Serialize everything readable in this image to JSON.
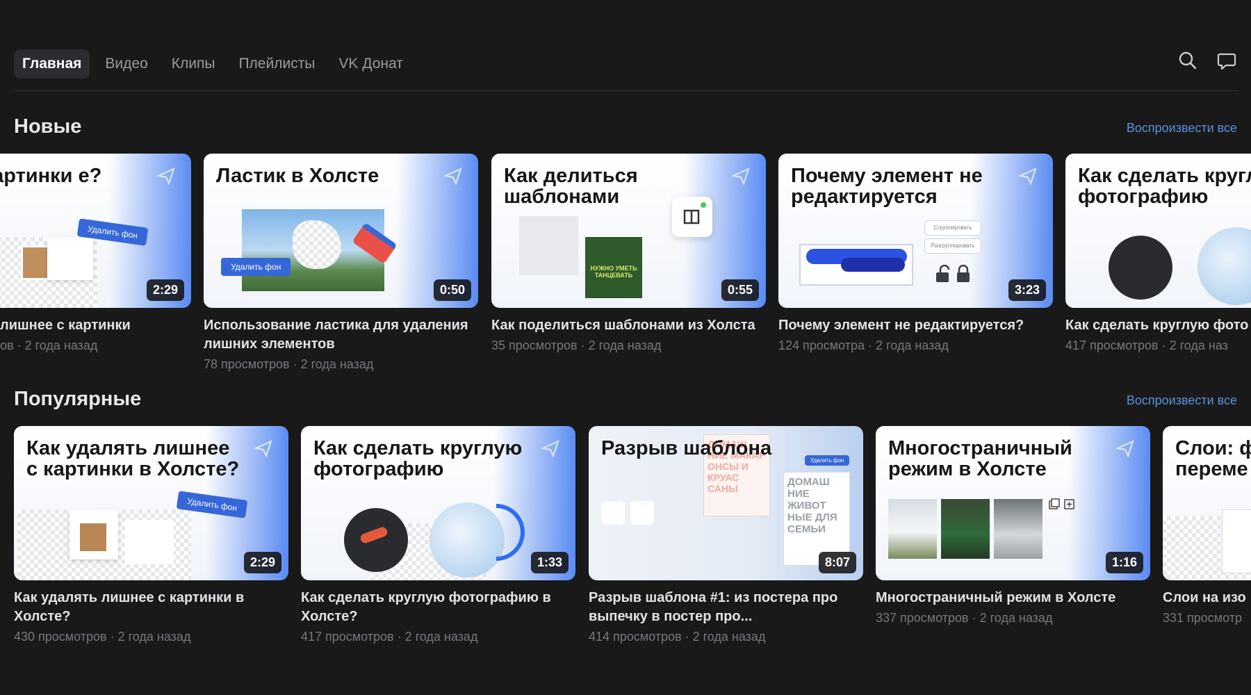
{
  "nav": {
    "tabs": [
      "Главная",
      "Видео",
      "Клипы",
      "Плейлисты",
      "VK Донат"
    ],
    "active_tab": "Главная",
    "icons": [
      "search-icon",
      "chat-icon"
    ]
  },
  "sections": [
    {
      "title": "Новые",
      "play_all": "Воспроизвести все",
      "videos": [
        {
          "thumb_text": "лять с картинки е?",
          "thumb_button": "Удалить фон",
          "duration": "2:29",
          "title": "лишнее с картинки",
          "meta": "ов · 2 года назад"
        },
        {
          "thumb_text": "Ластик в Холсте",
          "thumb_button": "Удалить фон",
          "duration": "0:50",
          "title": "Использование ластика для удаления лишних элементов",
          "meta": "78 просмотров · 2 года назад"
        },
        {
          "thumb_text": "Как делиться шаблонами",
          "thumb_card_text": "НУЖНО УМЕТЬ ТАНЦЕВАТЬ",
          "duration": "0:55",
          "title": "Как поделиться шаблонами из Холста",
          "meta": "35 просмотров · 2 года назад"
        },
        {
          "thumb_text": "Почему элемент не редактируется",
          "thumb_buttons": [
            "Сгруппировать",
            "Разгруппировать"
          ],
          "duration": "3:23",
          "title": "Почему элемент не редактируется?",
          "meta": "124 просмотра · 2 года назад"
        },
        {
          "thumb_text": "Как сделать круглую фотографию",
          "duration": "",
          "title": "Как сделать круглую фото в Холсте?",
          "meta": "417 просмотров · 2 года наз"
        }
      ]
    },
    {
      "title": "Популярные",
      "play_all": "Воспроизвести все",
      "videos": [
        {
          "thumb_text": "Как удалять лишнее с картинки в Холсте?",
          "thumb_button": "Удалить фон",
          "duration": "2:29",
          "title": "Как удалять лишнее с картинки в Холсте?",
          "meta": "430 просмотров · 2 года назад"
        },
        {
          "thumb_text": "Как сделать круглую фотографию",
          "duration": "1:33",
          "title": "Как сделать круглую фотографию в Холсте?",
          "meta": "417 просмотров · 2 года назад"
        },
        {
          "thumb_text": "Разрыв шаблона",
          "thumb_poster_1": "ДОМАШ НИЕ МАКАР ОНСЫ И КРУАС САНЫ",
          "thumb_poster_2": "ДОМАШ НИЕ ЖИВОТ НЫЕ ДЛЯ СЕМЬИ",
          "thumb_button": "Удалить фон",
          "duration": "8:07",
          "title": "Разрыв шаблона #1: из постера про выпечку в постер про...",
          "meta": "414 просмотров · 2 года назад"
        },
        {
          "thumb_text": "Многостраничный режим в Холсте",
          "duration": "1:16",
          "title": "Многостраничный режим в Холсте",
          "meta": "337 просмотров · 2 года назад"
        },
        {
          "thumb_text": "Слои: фиксац переме",
          "duration": "",
          "title": "Слои на изо",
          "meta": "331 просмотр"
        }
      ]
    }
  ]
}
